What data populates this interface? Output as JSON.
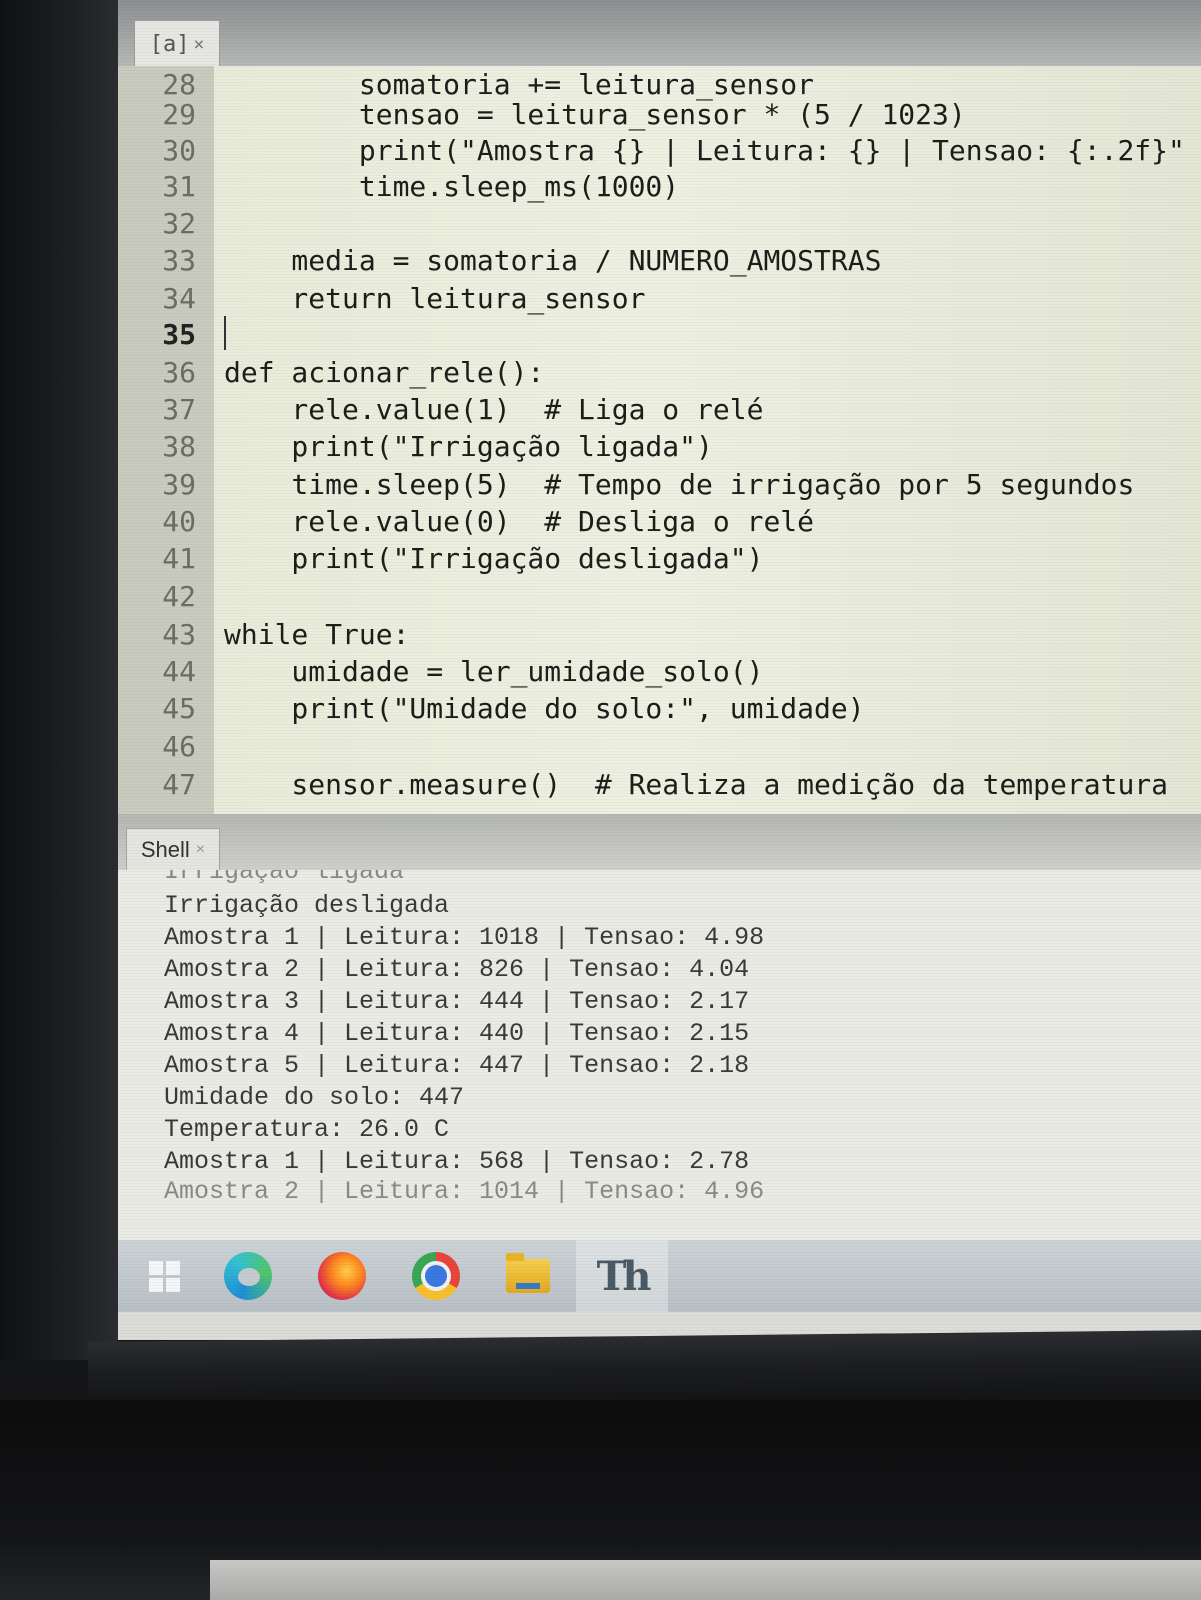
{
  "editor": {
    "tab": {
      "label": "[a]",
      "close": "×"
    },
    "lines": [
      {
        "num": "28",
        "code": "        somatoria += leitura_sensor"
      },
      {
        "num": "29",
        "code": "        tensao = leitura_sensor * (5 / 1023)"
      },
      {
        "num": "30",
        "code": "        print(\"Amostra {} | Leitura: {} | Tensao: {:.2f}\""
      },
      {
        "num": "31",
        "code": "        time.sleep_ms(1000)"
      },
      {
        "num": "32",
        "code": ""
      },
      {
        "num": "33",
        "code": "    media = somatoria / NUMERO_AMOSTRAS"
      },
      {
        "num": "34",
        "code": "    return leitura_sensor"
      },
      {
        "num": "35",
        "code": ""
      },
      {
        "num": "36",
        "code": "def acionar_rele():"
      },
      {
        "num": "37",
        "code": "    rele.value(1)  # Liga o relé"
      },
      {
        "num": "38",
        "code": "    print(\"Irrigação ligada\")"
      },
      {
        "num": "39",
        "code": "    time.sleep(5)  # Tempo de irrigação por 5 segundos"
      },
      {
        "num": "40",
        "code": "    rele.value(0)  # Desliga o relé"
      },
      {
        "num": "41",
        "code": "    print(\"Irrigação desligada\")"
      },
      {
        "num": "42",
        "code": ""
      },
      {
        "num": "43",
        "code": "while True:"
      },
      {
        "num": "44",
        "code": "    umidade = ler_umidade_solo()"
      },
      {
        "num": "45",
        "code": "    print(\"Umidade do solo:\", umidade)"
      },
      {
        "num": "46",
        "code": ""
      },
      {
        "num": "47",
        "code": "    sensor.measure()  # Realiza a medição da temperatura"
      }
    ]
  },
  "shell": {
    "tab": {
      "label": "Shell",
      "close": "×"
    },
    "lines": [
      "Irrigação ligada",
      "Irrigação desligada",
      "Amostra 1 | Leitura: 1018 | Tensao: 4.98",
      "Amostra 2 | Leitura: 826 | Tensao: 4.04",
      "Amostra 3 | Leitura: 444 | Tensao: 2.17",
      "Amostra 4 | Leitura: 440 | Tensao: 2.15",
      "Amostra 5 | Leitura: 447 | Tensao: 2.18",
      "Umidade do solo: 447",
      "Temperatura: 26.0 C",
      "Amostra 1 | Leitura: 568 | Tensao: 2.78",
      "Amostra 2 | Leitura: 1014 | Tensao: 4.96"
    ]
  },
  "taskbar": {
    "items": [
      {
        "name": "start-button",
        "icon": "windows-icon"
      },
      {
        "name": "taskbar-edge",
        "icon": "edge-icon"
      },
      {
        "name": "taskbar-firefox",
        "icon": "firefox-icon"
      },
      {
        "name": "taskbar-chrome",
        "icon": "chrome-icon"
      },
      {
        "name": "taskbar-file-explorer",
        "icon": "folder-icon"
      },
      {
        "name": "taskbar-thonny",
        "icon": "thonny-icon",
        "glyph": "Th",
        "active": true
      }
    ]
  }
}
